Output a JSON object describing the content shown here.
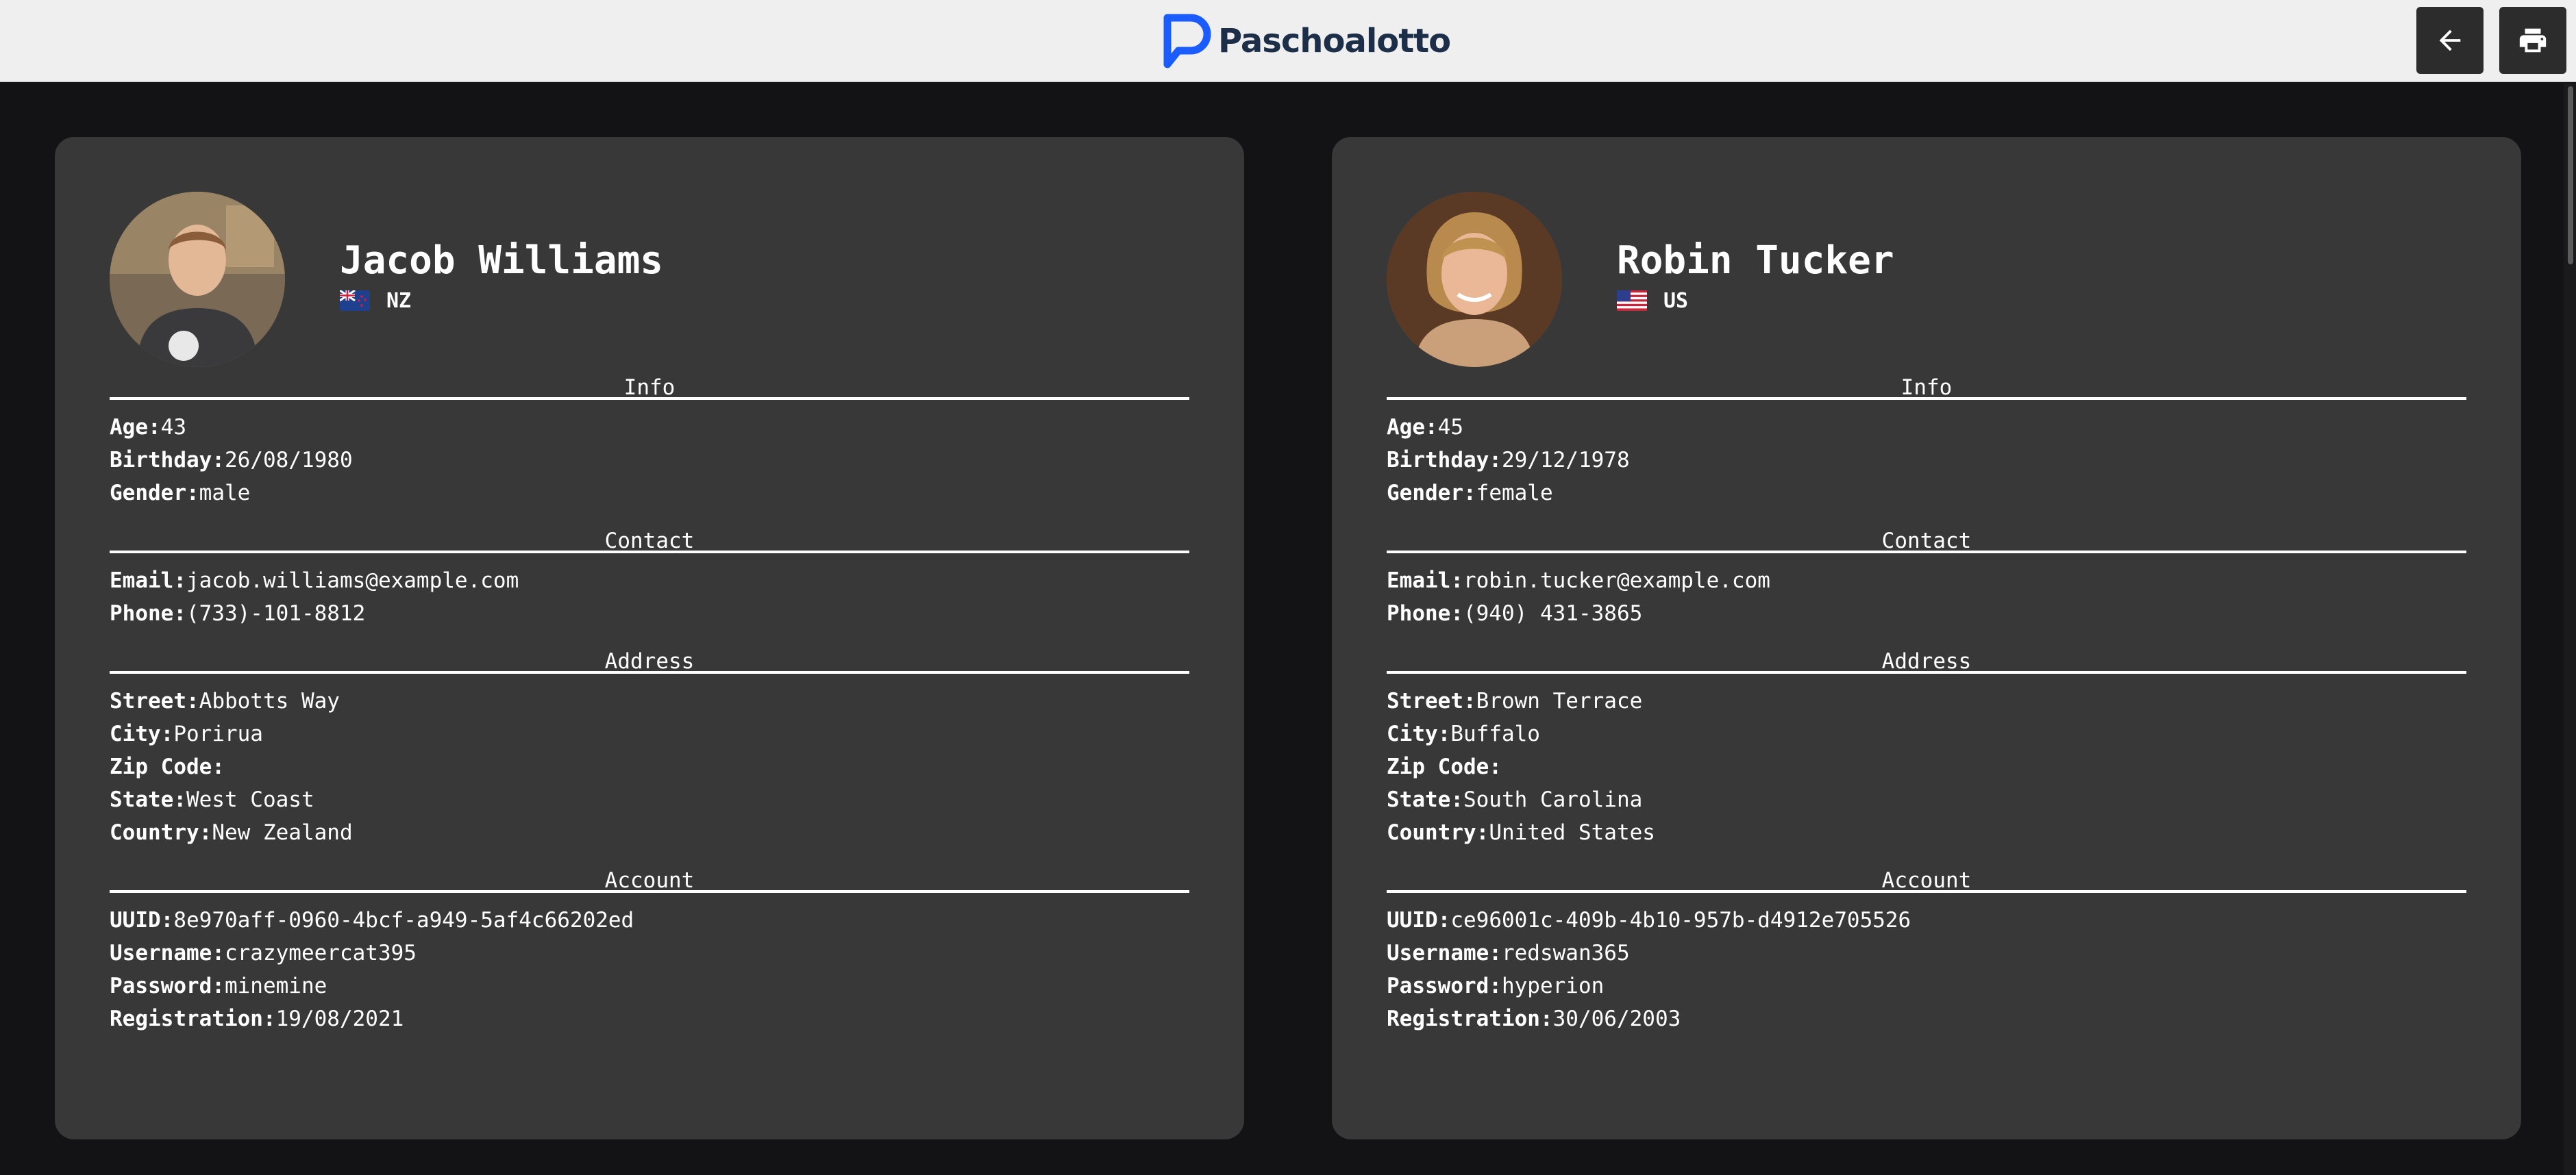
{
  "header": {
    "brand": "Paschoalotto",
    "brand_color": "#1d2e49",
    "logo_accent": "#1a5cff",
    "back_icon": "arrow-left-icon",
    "print_icon": "printer-icon"
  },
  "labels": {
    "info": "Info",
    "contact": "Contact",
    "address": "Address",
    "account": "Account",
    "age": "Age:",
    "birthday": "Birthday:",
    "gender": "Gender:",
    "email": "Email:",
    "phone": "Phone:",
    "street": "Street:",
    "city": "City:",
    "zip": "Zip Code:",
    "state": "State:",
    "country": "Country:",
    "uuid": "UUID:",
    "username": "Username:",
    "password": "Password:",
    "registration": "Registration:"
  },
  "users": [
    {
      "name": "Jacob Williams",
      "nat": "NZ",
      "age": "43",
      "birthday": "26/08/1980",
      "gender": "male",
      "email": "jacob.williams@example.com",
      "phone": "(733)-101-8812",
      "street": "Abbotts Way",
      "city": "Porirua",
      "zip": "",
      "state": "West Coast",
      "country": "New Zealand",
      "uuid": "8e970aff-0960-4bcf-a949-5af4c66202ed",
      "username": "crazymeercat395",
      "password": "minemine",
      "registration": "19/08/2021"
    },
    {
      "name": "Robin Tucker",
      "nat": "US",
      "age": "45",
      "birthday": "29/12/1978",
      "gender": "female",
      "email": "robin.tucker@example.com",
      "phone": "(940) 431-3865",
      "street": "Brown Terrace",
      "city": "Buffalo",
      "zip": "",
      "state": "South Carolina",
      "country": "United States",
      "uuid": "ce96001c-409b-4b10-957b-d4912e705526",
      "username": "redswan365",
      "password": "hyperion",
      "registration": "30/06/2003"
    }
  ]
}
